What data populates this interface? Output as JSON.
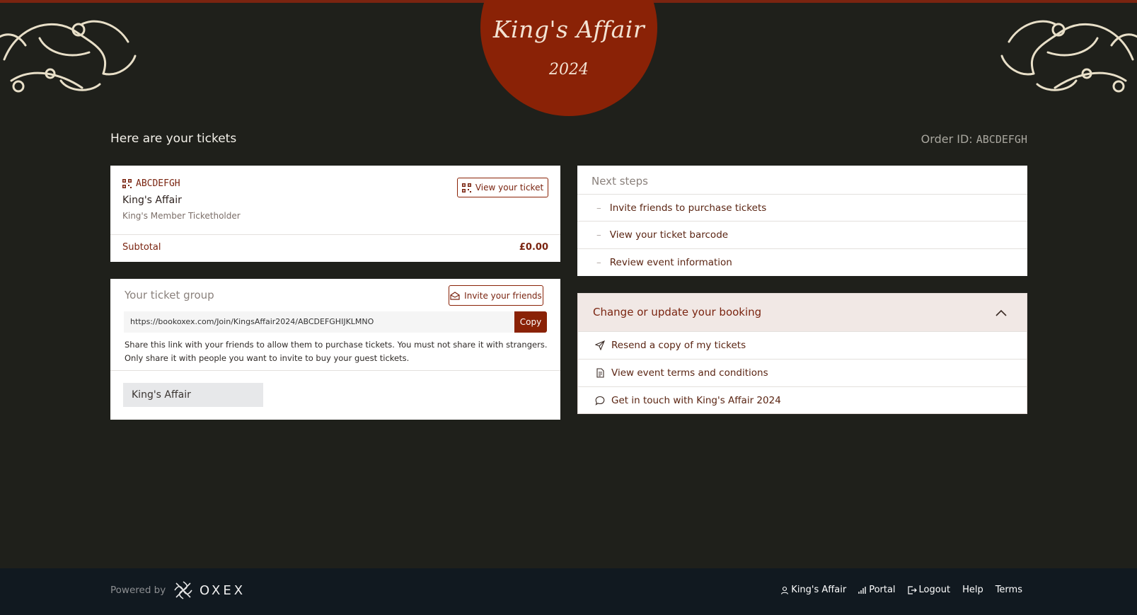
{
  "brand": {
    "title": "King's Affair",
    "year": "2024",
    "primary_color": "#8a2206",
    "background_color": "#1f201b"
  },
  "page": {
    "heading": "Here are your tickets",
    "order_id_label": "Order ID:",
    "order_id": "ABCDEFGH"
  },
  "ticket": {
    "code": "ABCDEFGH",
    "event_name": "King's Affair",
    "ticket_type": "King's Member Ticketholder",
    "view_button": "View your ticket",
    "subtotal_label": "Subtotal",
    "subtotal_value": "£0.00"
  },
  "group": {
    "title": "Your ticket group",
    "invite_button": "Invite your friends",
    "link": "https://bookoxex.com/Join/KingsAffair2024/ABCDEFGHIJKLMNO",
    "copy_button": "Copy",
    "note": "Share this link with your friends to allow them to purchase tickets. You must not share it with strangers. Only share it with people you want to invite to buy your guest tickets.",
    "tag": "King's Affair"
  },
  "next_steps": {
    "title": "Next steps",
    "items": [
      "Invite friends to purchase tickets",
      "View your ticket barcode",
      "Review event information"
    ]
  },
  "booking": {
    "title": "Change or update your booking",
    "items": [
      {
        "label": "Resend a copy of my tickets",
        "icon": "send-icon"
      },
      {
        "label": "View event terms and conditions",
        "icon": "document-icon"
      },
      {
        "label": "Get in touch with King's Affair 2024",
        "icon": "chat-icon"
      }
    ]
  },
  "footer": {
    "powered_by": "Powered by",
    "logo_text": "OXEX",
    "links": [
      {
        "label": "King's Affair",
        "icon": "user-icon"
      },
      {
        "label": "Portal",
        "icon": "bar-chart-icon"
      },
      {
        "label": "Logout",
        "icon": "logout-icon"
      },
      {
        "label": "Help",
        "icon": ""
      },
      {
        "label": "Terms",
        "icon": ""
      }
    ]
  }
}
